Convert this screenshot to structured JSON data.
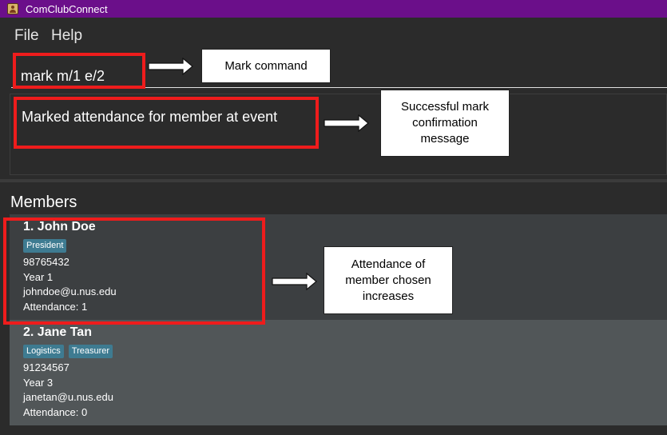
{
  "window": {
    "title": "ComClubConnect"
  },
  "menu": {
    "items": [
      "File",
      "Help"
    ]
  },
  "command": {
    "value": "mark m/1 e/2"
  },
  "result": {
    "message": "Marked attendance for member at event"
  },
  "members": {
    "heading": "Members",
    "list": [
      {
        "name": "1. John Doe",
        "tags": [
          "President"
        ],
        "phone": "98765432",
        "year": "Year 1",
        "email": "johndoe@u.nus.edu",
        "attendance": "Attendance: 1"
      },
      {
        "name": "2. Jane Tan",
        "tags": [
          "Logistics",
          "Treasurer"
        ],
        "phone": "91234567",
        "year": "Year 3",
        "email": "janetan@u.nus.edu",
        "attendance": "Attendance: 0"
      }
    ]
  },
  "annotations": {
    "command_label": "Mark command",
    "result_label": "Successful mark\nconfirmation\nmessage",
    "attendance_label": "Attendance of\nmember chosen\nincreases"
  },
  "colors": {
    "titlebar": "#6b0f8a",
    "background": "#2b2b2b",
    "tag": "#3e7b91",
    "highlight": "#ee1c1c"
  }
}
